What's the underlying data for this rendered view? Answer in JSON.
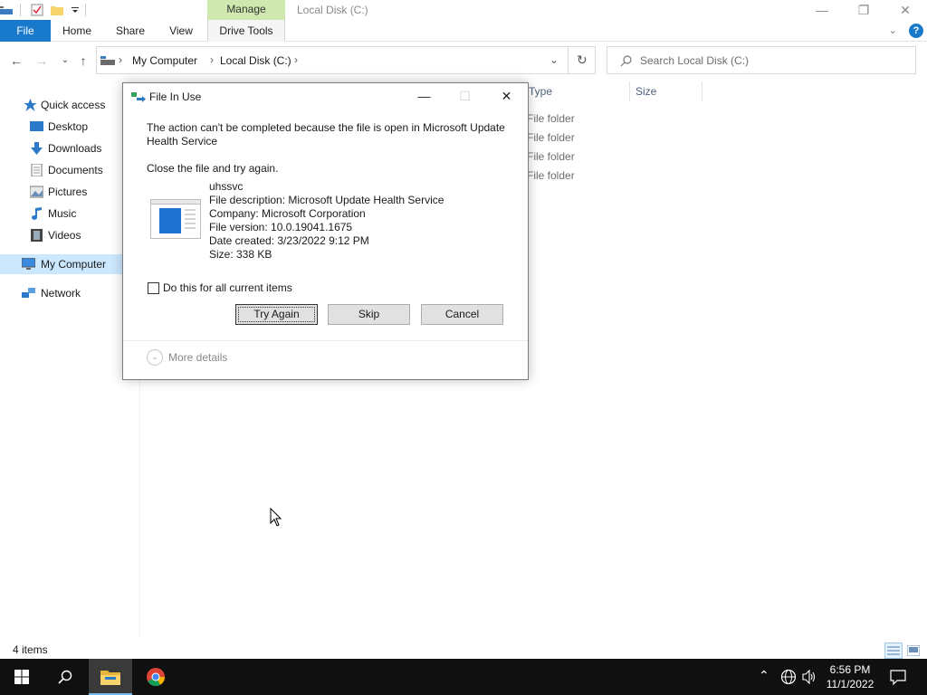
{
  "window": {
    "title": "Local Disk (C:)",
    "context_tab": "Manage"
  },
  "ribbon": {
    "tabs": [
      "File",
      "Home",
      "Share",
      "View",
      "Drive Tools"
    ]
  },
  "address": {
    "crumbs": [
      "My Computer",
      "Local Disk (C:)"
    ]
  },
  "search": {
    "placeholder": "Search Local Disk (C:)"
  },
  "sidebar": {
    "items": [
      {
        "label": "Quick access",
        "icon": "star-icon"
      },
      {
        "label": "Desktop",
        "icon": "desktop-icon"
      },
      {
        "label": "Downloads",
        "icon": "download-icon"
      },
      {
        "label": "Documents",
        "icon": "documents-icon"
      },
      {
        "label": "Pictures",
        "icon": "pictures-icon"
      },
      {
        "label": "Music",
        "icon": "music-icon"
      },
      {
        "label": "Videos",
        "icon": "videos-icon"
      },
      {
        "label": "My Computer",
        "icon": "computer-icon"
      },
      {
        "label": "Network",
        "icon": "network-icon"
      }
    ],
    "selected": "My Computer"
  },
  "file_list": {
    "columns": [
      "Type",
      "Size"
    ],
    "rows": [
      {
        "type": "File folder"
      },
      {
        "type": "File folder"
      },
      {
        "type": "File folder"
      },
      {
        "type": "File folder"
      }
    ]
  },
  "status": {
    "item_count": "4 items"
  },
  "dialog": {
    "title": "File In Use",
    "message_line1": "The action can't be completed because the file is open in Microsoft Update",
    "message_line2": "Health Service",
    "instruction": "Close the file and try again.",
    "file": {
      "name": "uhssvc",
      "description": "File description: Microsoft Update Health Service",
      "company": "Company: Microsoft Corporation",
      "version": "File version: 10.0.19041.1675",
      "created": "Date created: 3/23/2022 9:12 PM",
      "size": "Size: 338 KB"
    },
    "checkbox_label": "Do this for all current items",
    "checkbox_checked": false,
    "buttons": {
      "try_again": "Try Again",
      "skip": "Skip",
      "cancel": "Cancel"
    },
    "more_details": "More details"
  },
  "taskbar": {
    "time": "6:56 PM",
    "date": "11/1/2022"
  },
  "colors": {
    "accent": "#1979ca",
    "manage_tab": "#cfe8b0",
    "selected_nav": "#cce8ff",
    "taskbar": "#101010"
  }
}
